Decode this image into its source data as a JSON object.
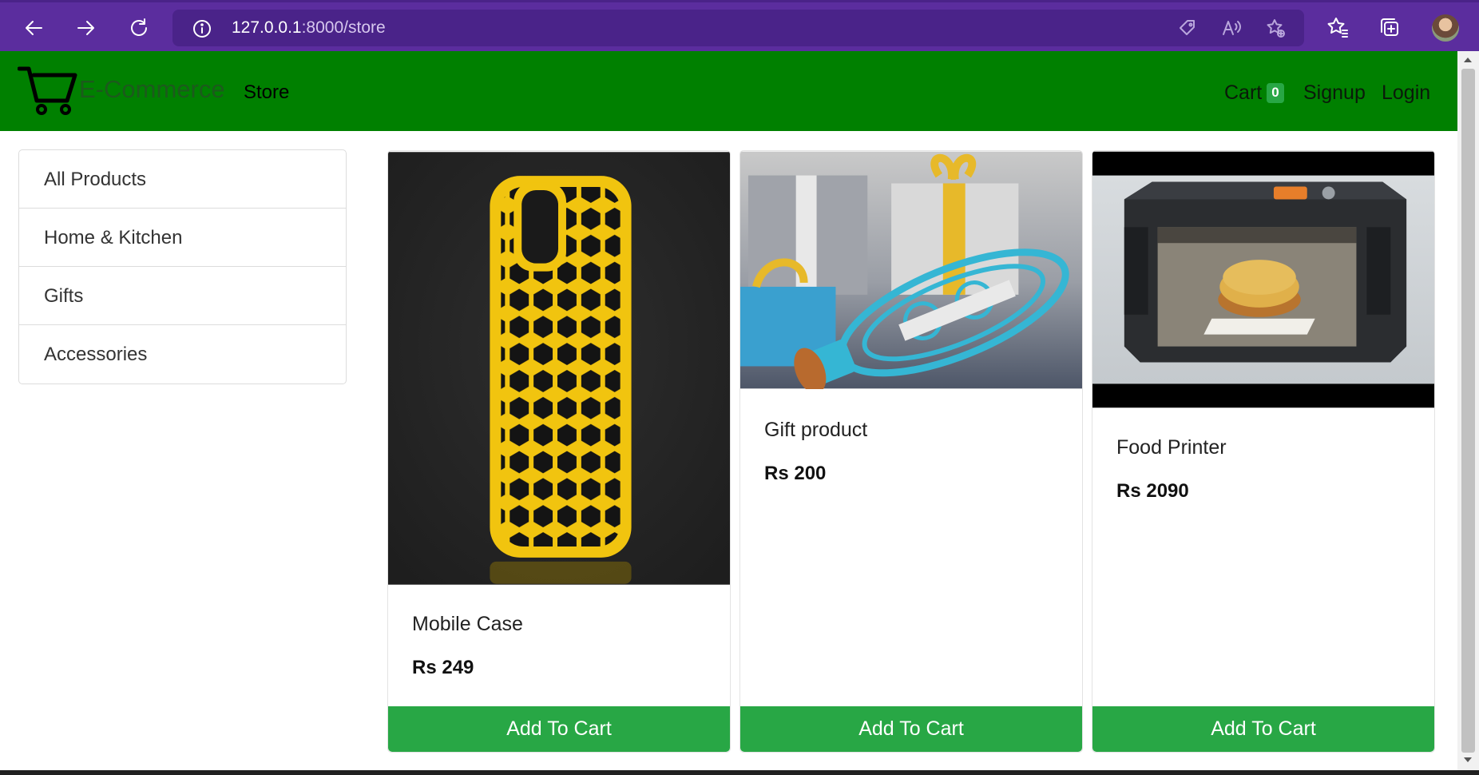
{
  "browser": {
    "url_host": "127.0.0.1",
    "url_path": ":8000/store"
  },
  "navbar": {
    "brand": "E-Commerce",
    "store_link": "Store",
    "cart_label": "Cart",
    "cart_count": "0",
    "signup": "Signup",
    "login": "Login",
    "bg_color": "#008000"
  },
  "sidebar": {
    "items": [
      {
        "label": "All Products"
      },
      {
        "label": "Home & Kitchen"
      },
      {
        "label": "Gifts"
      },
      {
        "label": "Accessories"
      }
    ]
  },
  "products": [
    {
      "name": "Mobile Case",
      "price": "Rs 249",
      "button": "Add To Cart",
      "image": "yellow-phone-case"
    },
    {
      "name": "Gift product",
      "price": "Rs 200",
      "button": "Add To Cart",
      "image": "blue-decorative-bottle"
    },
    {
      "name": "Food Printer",
      "price": "Rs 2090",
      "button": "Add To Cart",
      "image": "3d-food-printer"
    }
  ],
  "colors": {
    "button_green": "#28a745",
    "browser_purple": "#5b2d9e"
  }
}
